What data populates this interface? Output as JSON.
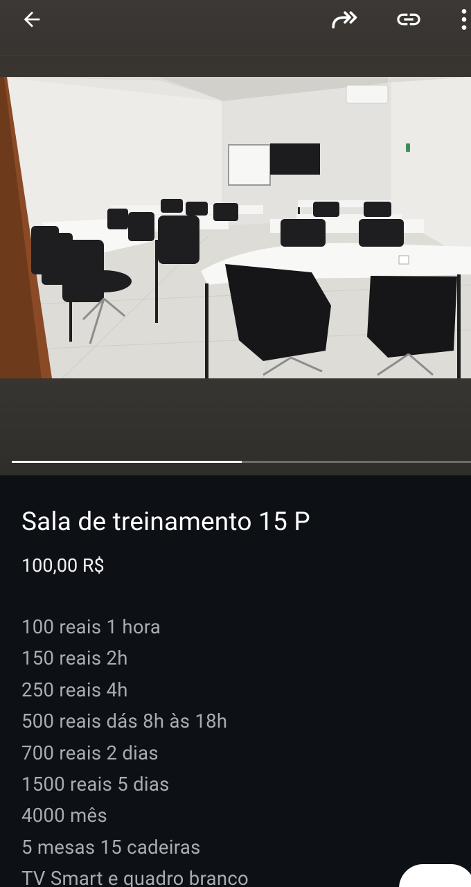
{
  "header": {
    "back_icon": "arrow-left-icon",
    "share_icon": "share-forward-icon",
    "link_icon": "link-icon",
    "more_icon": "more-vertical-icon"
  },
  "gallery": {
    "progress": 0.5,
    "photo_description_icon": "training-room-photo"
  },
  "listing": {
    "title": "Sala de treinamento 15 P",
    "price": "100,00 R$",
    "description": [
      "100 reais 1 hora",
      "150 reais 2h",
      "250 reais 4h",
      "500 reais dás 8h às 18h",
      "700 reais 2 dias",
      "1500 reais 5 dias",
      "4000 mês",
      "5 mesas 15 cadeiras",
      "TV Smart e quadro branco"
    ]
  },
  "colors": {
    "background": "#0d1116",
    "title": "#ffffff",
    "description": "#a9adb1",
    "progress_fill": "#f2f2f2",
    "progress_track": "#6e6c68"
  }
}
